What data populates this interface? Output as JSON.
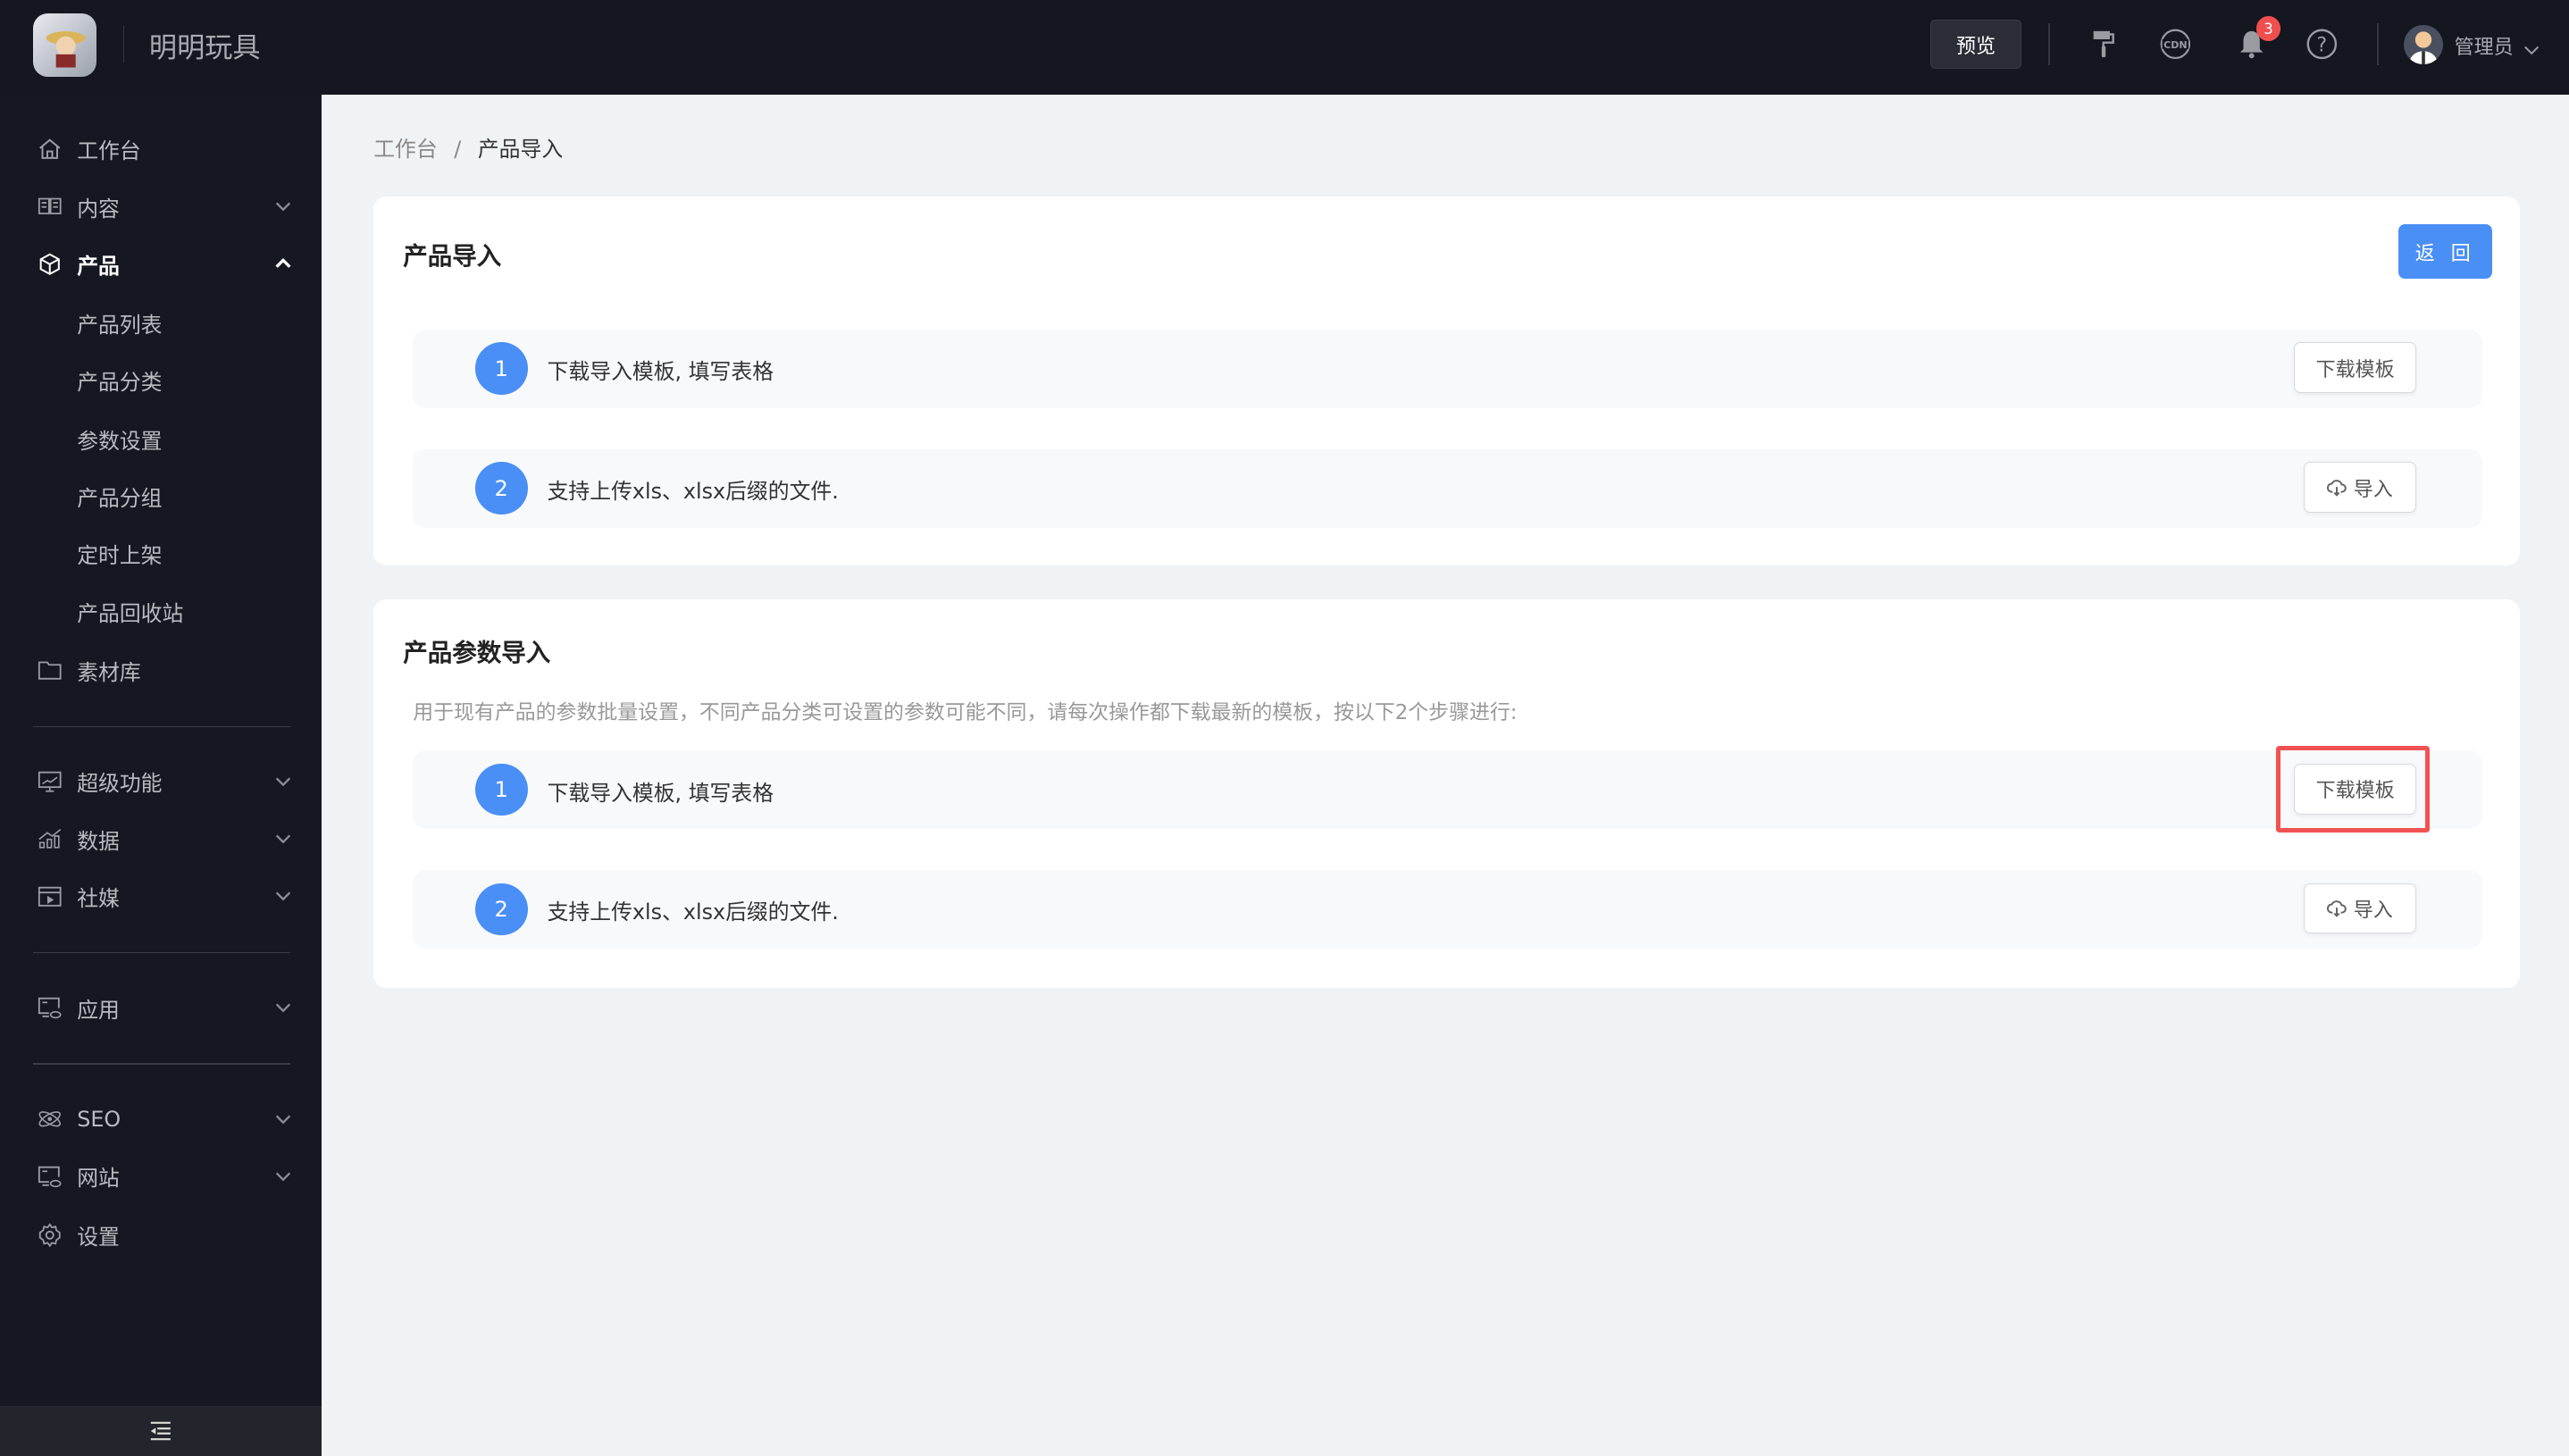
{
  "header": {
    "brand": "明明玩具",
    "preview_label": "预览",
    "notification_count": "3",
    "icons": [
      "paint-roller-icon",
      "cdn-globe-icon",
      "bell-icon",
      "help-icon"
    ],
    "user_name": "管理员"
  },
  "sidebar": {
    "items": [
      {
        "label": "工作台",
        "icon": "home-icon"
      },
      {
        "label": "内容",
        "icon": "book-icon",
        "chevron": "down"
      },
      {
        "label": "产品",
        "icon": "box-icon",
        "chevron": "up",
        "active": true
      },
      {
        "label": "产品列表",
        "sub": true
      },
      {
        "label": "产品分类",
        "sub": true
      },
      {
        "label": "参数设置",
        "sub": true
      },
      {
        "label": "产品分组",
        "sub": true
      },
      {
        "label": "定时上架",
        "sub": true
      },
      {
        "label": "产品回收站",
        "sub": true
      },
      {
        "label": "素材库",
        "icon": "folder-icon"
      },
      {
        "label": "超级功能",
        "icon": "monitor-chart-icon",
        "chevron": "down"
      },
      {
        "label": "数据",
        "icon": "bar-chart-icon",
        "chevron": "down"
      },
      {
        "label": "社媒",
        "icon": "video-icon",
        "chevron": "down"
      },
      {
        "label": "应用",
        "icon": "app-screen-icon",
        "chevron": "down"
      },
      {
        "label": "SEO",
        "icon": "atom-icon",
        "chevron": "down"
      },
      {
        "label": "网站",
        "icon": "website-icon",
        "chevron": "down"
      },
      {
        "label": "设置",
        "icon": "gear-icon"
      }
    ]
  },
  "breadcrumb": {
    "home": "工作台",
    "sep": "/",
    "current": "产品导入"
  },
  "card1": {
    "title": "产品导入",
    "back_label": "返 回",
    "steps": [
      {
        "num": "1",
        "text": "下载导入模板, 填写表格",
        "button": "下载模板"
      },
      {
        "num": "2",
        "text": "支持上传xls、xlsx后缀的文件.",
        "button": "导入"
      }
    ]
  },
  "card2": {
    "title": "产品参数导入",
    "description": "用于现有产品的参数批量设置，不同产品分类可设置的参数可能不同，请每次操作都下载最新的模板，按以下2个步骤进行:",
    "steps": [
      {
        "num": "1",
        "text": "下载导入模板, 填写表格",
        "button": "下载模板"
      },
      {
        "num": "2",
        "text": "支持上传xls、xlsx后缀的文件.",
        "button": "导入"
      }
    ]
  },
  "colors": {
    "accent": "#4a8ff5",
    "highlight": "#f05252",
    "header_bg": "#141720",
    "sidebar_bg": "#151821"
  }
}
